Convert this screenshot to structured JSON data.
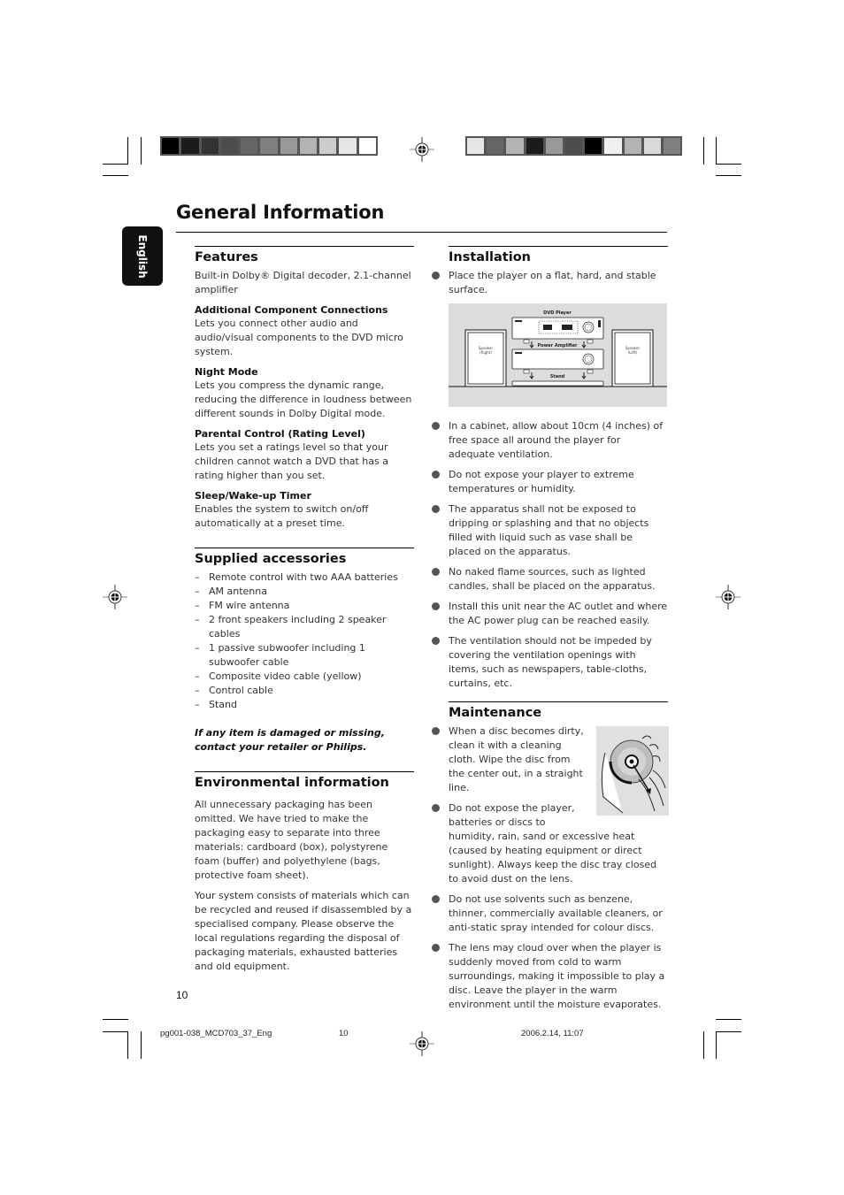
{
  "colors": {
    "text": "#333333",
    "heading": "#111111",
    "tab_bg": "#111111",
    "figure_bg": "#dcdcdc",
    "bullet": "#555555"
  },
  "color_bars": {
    "left": [
      "#000000",
      "#1b1b1b",
      "#333333",
      "#4d4d4d",
      "#666666",
      "#808080",
      "#999999",
      "#b3b3b3",
      "#cccccc",
      "#e6e6e6",
      "#ffffff"
    ],
    "right": [
      "#e6e6e6",
      "#666666",
      "#b3b3b3",
      "#1b1b1b",
      "#999999",
      "#4d4d4d",
      "#000000",
      "#f0f0f0",
      "#b3b3b3",
      "#d9d9d9",
      "#808080"
    ]
  },
  "page": {
    "title": "General Information",
    "language_tab": "English",
    "page_number": "10"
  },
  "features": {
    "heading": "Features",
    "intro": "Built-in Dolby® Digital decoder, 2.1-channel amplifier",
    "items": [
      {
        "title": "Additional Component Connections",
        "text": "Lets you connect other audio and audio/visual components to the DVD micro system."
      },
      {
        "title": "Night Mode",
        "text": "Lets you compress the dynamic range, reducing the difference in loudness between different sounds in Dolby Digital mode."
      },
      {
        "title": "Parental Control (Rating Level)",
        "text": "Lets you set a ratings level so that your children cannot watch a DVD that has a rating higher than you set."
      },
      {
        "title": "Sleep/Wake-up Timer",
        "text": "Enables the system to switch on/off automatically at a preset time."
      }
    ]
  },
  "accessories": {
    "heading": "Supplied accessories",
    "items": [
      "Remote control with two AAA batteries",
      "AM antenna",
      "FM wire antenna",
      "2 front speakers including 2 speaker cables",
      "1 passive subwoofer including 1 subwoofer cable",
      "Composite video cable (yellow)",
      "Control cable",
      "Stand"
    ],
    "note": "If any item is damaged or missing, contact your retailer or Philips."
  },
  "environment": {
    "heading": "Environmental information",
    "paragraphs": [
      "All unnecessary packaging has been omitted. We have tried to make the packaging easy to separate into three materials: cardboard (box), polystyrene foam (buffer) and polyethylene (bags, protective foam sheet).",
      "Your system consists of materials which can be recycled and reused if disassembled by a specialised company. Please observe the local regulations regarding the disposal of packaging materials, exhausted batteries and old equipment."
    ]
  },
  "installation": {
    "heading": "Installation",
    "first_item": "Place the player on a flat, hard, and stable surface.",
    "figure": {
      "dvd_player": "DVD Player",
      "power_amplifier": "Power Amplifier",
      "stand": "Stand",
      "speaker_right": "Speaker (Right)",
      "speaker_left": "Speaker (Left)"
    },
    "items": [
      "In a cabinet, allow about 10cm (4 inches) of free space all around the player for adequate ventilation.",
      "Do not expose your player to extreme temperatures or humidity.",
      "The apparatus shall not be exposed to dripping or splashing and that no objects  filled with liquid such as vase shall be placed on the apparatus.",
      "No naked flame sources, such as lighted candles, shall be placed on the apparatus.",
      "Install this unit near the AC outlet and where the AC power plug can be reached easily.",
      "The ventilation should not be impeded by covering the ventilation openings with items, such as newspapers, table-cloths, curtains, etc."
    ]
  },
  "maintenance": {
    "heading": "Maintenance",
    "items": [
      "When a disc becomes dirty, clean it with a cleaning cloth. Wipe the disc from the center out, in a straight line.",
      "Do not expose the player, batteries or discs to humidity, rain, sand or excessive heat (caused by heating equipment or direct sunlight). Always keep the disc tray closed to avoid dust on the lens.",
      "Do not use solvents such as benzene, thinner, commercially available cleaners, or anti-static spray intended for colour discs.",
      "The lens may cloud over when the player is suddenly moved from cold to warm surroundings, making it impossible to play a disc. Leave the player in the warm environment until the moisture evaporates."
    ]
  },
  "print_footer": {
    "file": "pg001-038_MCD703_37_Eng",
    "page": "10",
    "timestamp": "2006.2.14, 11:07"
  }
}
